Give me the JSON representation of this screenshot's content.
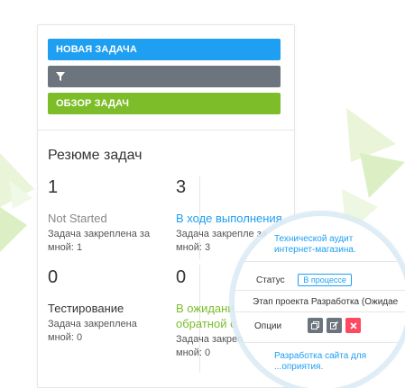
{
  "actions": {
    "new_task_label": "НОВАЯ ЗАДАЧА",
    "overview_label": "ОБЗОР ЗАДАЧ"
  },
  "summary": {
    "title": "Резюме задач",
    "stats": [
      {
        "count": "1",
        "label": "Not Started",
        "sub": "Задача закреплена за мной: 1"
      },
      {
        "count": "3",
        "label": "В ходе выполнения",
        "sub": "Задача закрепле за мной: 3"
      },
      {
        "count": "0",
        "label": "Тестирование",
        "sub": "Задача закреплена мной: 0"
      },
      {
        "count": "0",
        "label": "В ожидани обратной с",
        "sub": "Задача закреп за мной: 0"
      }
    ]
  },
  "detail": {
    "top_link": "Технической аудит интернет-магазина.",
    "status_label": "Статус",
    "status_value": "В процессе",
    "stage_label": "Этап проекта",
    "stage_value": "Разработка (Ожидае",
    "options_label": "Опции",
    "bottom_link": "Разработка сайта для ...оприятия."
  },
  "colors": {
    "blue": "#1e9ff2",
    "gray": "#6c757d",
    "green": "#7cbd29",
    "red": "#ff4961"
  }
}
